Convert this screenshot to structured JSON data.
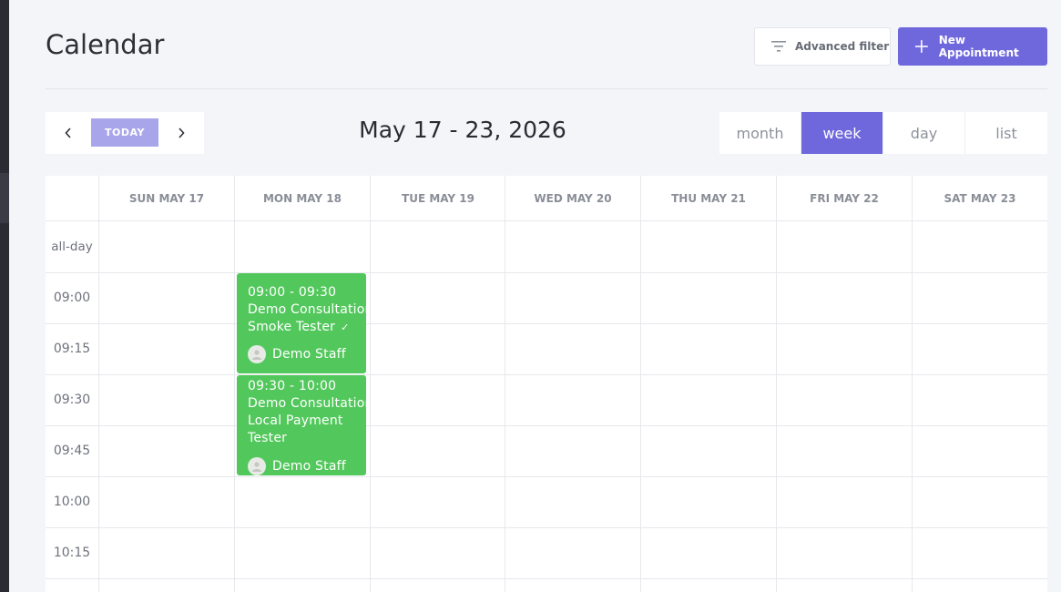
{
  "page": {
    "title": "Calendar"
  },
  "toolbar": {
    "advanced_filter_label": "Advanced filter",
    "new_appointment_label": "New Appointment"
  },
  "navigation": {
    "today_label": "TODAY",
    "range_title": "May 17 - 23, 2026"
  },
  "views": [
    {
      "label": "month",
      "active": false
    },
    {
      "label": "week",
      "active": true
    },
    {
      "label": "day",
      "active": false
    },
    {
      "label": "list",
      "active": false
    }
  ],
  "calendar": {
    "days": [
      "SUN MAY 17",
      "MON MAY 18",
      "TUE MAY 19",
      "WED MAY 20",
      "THU MAY 21",
      "FRI MAY 22",
      "SAT MAY 23"
    ],
    "all_day_label": "all-day",
    "times": [
      "09:00",
      "09:15",
      "09:30",
      "09:45",
      "10:00",
      "10:15"
    ],
    "events": [
      {
        "time": "09:00 - 09:30",
        "service": "Demo Consultation",
        "customer": "Smoke Tester",
        "status_icon": "check-icon",
        "staff": "Demo Staff"
      },
      {
        "time": "09:30 - 10:00",
        "service": "Demo Consultation",
        "customer": "Local Payment Tester",
        "staff": "Demo Staff"
      }
    ]
  },
  "colors": {
    "accent": "#6f68dc",
    "today_button": "#a9a5ea",
    "event_green": "#52c85c",
    "background": "#f4f5f9"
  }
}
